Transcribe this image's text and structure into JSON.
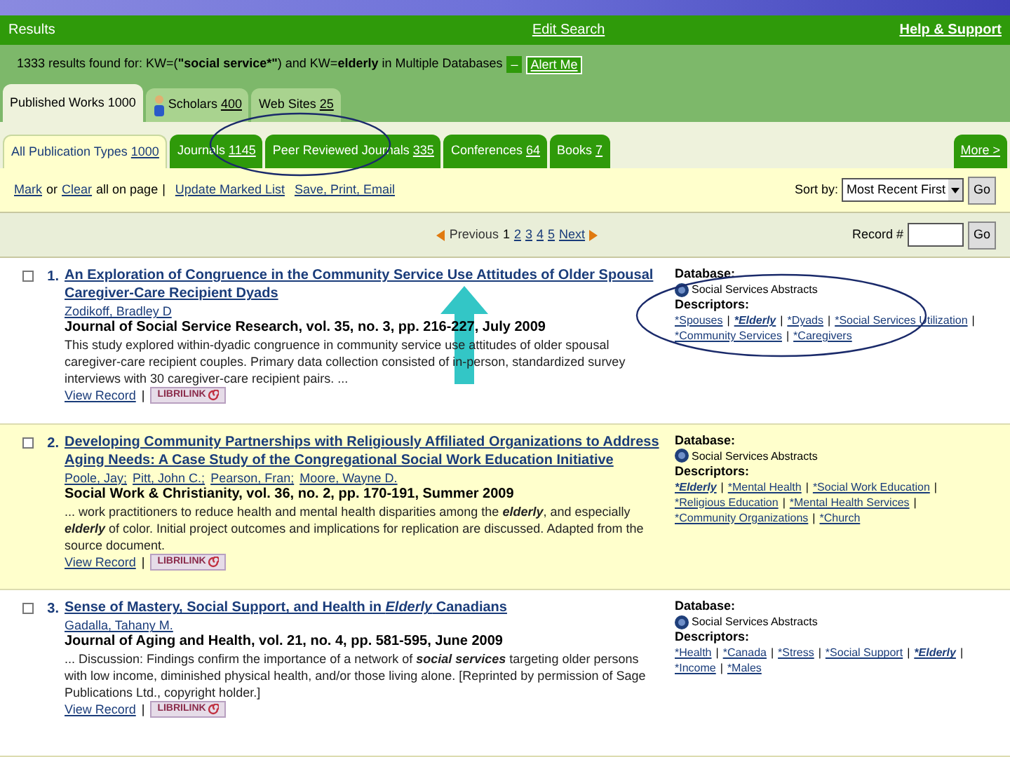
{
  "header": {
    "title": "Results",
    "edit_search": "Edit Search",
    "help": "Help & Support"
  },
  "summary": {
    "segments": [
      {
        "text": "1333 results found for: KW=(",
        "bold": false
      },
      {
        "text": "\"social service*\"",
        "bold": true
      },
      {
        "text": ") and KW=",
        "bold": false
      },
      {
        "text": "elderly",
        "bold": true
      },
      {
        "text": " in Multiple Databases",
        "bold": false
      }
    ],
    "toggle": "–",
    "alert": "Alert Me"
  },
  "tabs": [
    {
      "label": "Published Works",
      "count": "1000",
      "kind": "plain",
      "selected": true
    },
    {
      "label": "Scholars",
      "count": "400",
      "kind": "people",
      "selected": false
    },
    {
      "label": "Web Sites",
      "count": "25",
      "kind": "plain",
      "selected": false
    }
  ],
  "subtabs": [
    {
      "label": "All Publication Types",
      "count": "1000",
      "selected": true
    },
    {
      "label": "Journals",
      "count": "1145",
      "selected": false
    },
    {
      "label": "Peer Reviewed Journals",
      "count": "335",
      "selected": false
    },
    {
      "label": "Conferences",
      "count": "64",
      "selected": false
    },
    {
      "label": "Books",
      "count": "7",
      "selected": false
    }
  ],
  "more": "More >",
  "toolbar": [
    {
      "text": "Mark",
      "kind": "link"
    },
    {
      "text": "or",
      "kind": "text"
    },
    {
      "text": "Clear",
      "kind": "link"
    },
    {
      "text": "all on page",
      "kind": "text"
    },
    {
      "text": "|",
      "kind": "text"
    },
    {
      "text": "Update Marked List",
      "kind": "link"
    },
    {
      "text": "Save, Print, Email",
      "kind": "link"
    }
  ],
  "sort": {
    "label": "Sort by:",
    "value": "Most Recent First",
    "button": "Go"
  },
  "pagination": {
    "previous": "Previous",
    "pages": [
      {
        "label": "1",
        "selected": true
      },
      {
        "label": "2",
        "selected": false
      },
      {
        "label": "3",
        "selected": false
      },
      {
        "label": "4",
        "selected": false
      },
      {
        "label": "5",
        "selected": false
      }
    ],
    "next": "Next"
  },
  "record": {
    "label": "Record #",
    "button": "Go"
  },
  "separator": "|",
  "results": [
    {
      "number": "1.",
      "checked": false,
      "title": [
        {
          "text": "An Exploration of Congruence in the Community Service Use Attitudes of Older Spousal Caregiver-Care Recipient Dyads",
          "em": false
        }
      ],
      "authors": [
        "Zodikoff, Bradley D"
      ],
      "source": "Journal of Social Service Research, vol. 35, no. 3, pp. 216-227, July 2009",
      "abstract": [
        {
          "text": "This study explored within-dyadic congruence in community service use attitudes of older spousal caregiver-care recipient couples. Primary data collection consisted of in-person, standardized survey interviews with 30 caregiver-care recipient pairs. ...",
          "em": false
        }
      ],
      "view_record": "View Record",
      "librilink": "LIBRILINK",
      "database_label": "Database:",
      "database": "Social Services Abstracts",
      "descriptors_label": "Descriptors:",
      "descriptors": [
        {
          "text": "*Spouses",
          "match": false
        },
        {
          "text": "*Elderly",
          "match": true
        },
        {
          "text": "*Dyads",
          "match": false
        },
        {
          "text": "*Social Services Utilization",
          "match": false
        },
        {
          "text": "*Community Services",
          "match": false
        },
        {
          "text": "*Caregivers",
          "match": false
        }
      ]
    },
    {
      "number": "2.",
      "checked": false,
      "title": [
        {
          "text": "Developing Community Partnerships with Religiously Affiliated Organizations to Address Aging Needs: A Case Study of the Congregational Social Work Education Initiative",
          "em": false
        }
      ],
      "authors": [
        "Poole, Jay;",
        "Pitt, John C.;",
        "Pearson, Fran;",
        "Moore, Wayne D."
      ],
      "source": "Social Work & Christianity, vol. 36, no. 2, pp. 170-191, Summer 2009",
      "abstract": [
        {
          "text": "... work practitioners to reduce health and mental health disparities among the ",
          "em": false
        },
        {
          "text": "elderly",
          "em": true
        },
        {
          "text": ", and especially ",
          "em": false
        },
        {
          "text": "elderly",
          "em": true
        },
        {
          "text": " of color. Initial project outcomes and implications for replication are discussed. Adapted from the source document.",
          "em": false
        }
      ],
      "view_record": "View Record",
      "librilink": "LIBRILINK",
      "database_label": "Database:",
      "database": "Social Services Abstracts",
      "descriptors_label": "Descriptors:",
      "descriptors": [
        {
          "text": "*Elderly",
          "match": true
        },
        {
          "text": "*Mental Health",
          "match": false
        },
        {
          "text": "*Social Work Education",
          "match": false
        },
        {
          "text": "*Religious Education",
          "match": false
        },
        {
          "text": "*Mental Health Services",
          "match": false
        },
        {
          "text": "*Community Organizations",
          "match": false
        },
        {
          "text": "*Church",
          "match": false
        }
      ]
    },
    {
      "number": "3.",
      "checked": false,
      "title": [
        {
          "text": "Sense of Mastery, Social Support, and Health in ",
          "em": false
        },
        {
          "text": "Elderly",
          "em": true
        },
        {
          "text": " Canadians",
          "em": false
        }
      ],
      "authors": [
        "Gadalla, Tahany M."
      ],
      "source": "Journal of Aging and Health, vol. 21, no. 4, pp. 581-595, June 2009",
      "abstract": [
        {
          "text": "... Discussion: Findings confirm the importance of a network of ",
          "em": false
        },
        {
          "text": "social services",
          "em": true
        },
        {
          "text": " targeting older persons with low income, diminished physical health, and/or those living alone. [Reprinted by permission of Sage Publications Ltd., copyright holder.]",
          "em": false
        }
      ],
      "view_record": "View Record",
      "librilink": "LIBRILINK",
      "database_label": "Database:",
      "database": "Social Services Abstracts",
      "descriptors_label": "Descriptors:",
      "descriptors": [
        {
          "text": "*Health",
          "match": false
        },
        {
          "text": "*Canada",
          "match": false
        },
        {
          "text": "*Stress",
          "match": false
        },
        {
          "text": "*Social Support",
          "match": false
        },
        {
          "text": "*Elderly",
          "match": true
        },
        {
          "text": "*Income",
          "match": false
        },
        {
          "text": "*Males",
          "match": false
        }
      ]
    }
  ]
}
